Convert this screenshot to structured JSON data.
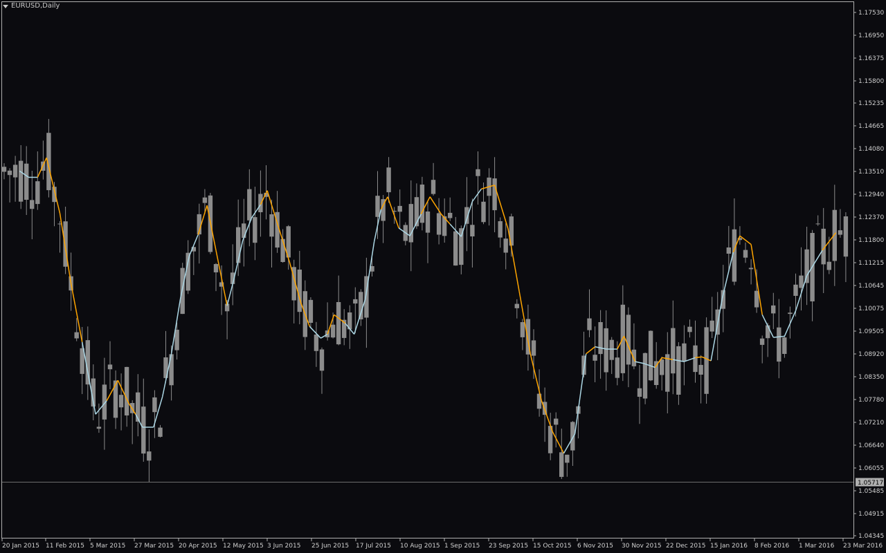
{
  "window": {
    "title": "EURUSD,Daily",
    "menu_icon": "triangle-down-icon"
  },
  "colors": {
    "background": "#0b0b0f",
    "candles": "#8c8c8c",
    "border": "#b0b0b0",
    "text": "#d0d0d0",
    "ma_up": "#add8e6",
    "ma_down": "#ffa500",
    "current_price_line": "#6e6e6e",
    "current_price_label_bg": "#b0b0b0"
  },
  "chart_data": {
    "type": "candlestick",
    "symbol": "EURUSD",
    "timeframe": "Daily",
    "ylim": [
      1.0434,
      1.1776
    ],
    "y_ticks": [
      "1.17530",
      "1.16950",
      "1.16375",
      "1.15800",
      "1.15235",
      "1.14665",
      "1.14080",
      "1.13510",
      "1.12940",
      "1.12370",
      "1.11800",
      "1.11215",
      "1.10645",
      "1.10075",
      "1.09505",
      "1.08920",
      "1.08350",
      "1.07780",
      "1.07210",
      "1.06640",
      "1.06055",
      "1.05485",
      "1.04915",
      "1.04345"
    ],
    "x_ticks": [
      "20 Jan 2015",
      "11 Feb 2015",
      "5 Mar 2015",
      "27 Mar 2015",
      "20 Apr 2015",
      "12 May 2015",
      "3 Jun 2015",
      "25 Jun 2015",
      "17 Jul 2015",
      "10 Aug 2015",
      "1 Sep 2015",
      "23 Sep 2015",
      "15 Oct 2015",
      "6 Nov 2015",
      "30 Nov 2015",
      "22 Dec 2015",
      "15 Jan 2016",
      "8 Feb 2016",
      "1 Mar 2016",
      "23 Mar 2016"
    ],
    "current_price": "1.05717",
    "grid": false,
    "indicators": [
      {
        "type": "moving-average",
        "up_color": "#add8e6",
        "down_color": "#ffa500",
        "points": [
          [
            14,
            1.1368,
            "down"
          ],
          [
            22,
            1.1352,
            "up"
          ],
          [
            30,
            1.1352,
            "up"
          ],
          [
            38,
            1.1402,
            "down"
          ],
          [
            50,
            1.126,
            "down"
          ],
          [
            60,
            1.108,
            "down"
          ],
          [
            70,
            1.093,
            "down"
          ],
          [
            82,
            1.0745,
            "up"
          ],
          [
            92,
            1.078,
            "up"
          ],
          [
            102,
            1.0832,
            "down"
          ],
          [
            112,
            1.0772,
            "down"
          ],
          [
            118,
            1.0745,
            "down"
          ],
          [
            124,
            1.0712,
            "up"
          ],
          [
            134,
            1.0712,
            "up"
          ],
          [
            142,
            1.079,
            "up"
          ],
          [
            150,
            1.09,
            "up"
          ],
          [
            158,
            1.104,
            "up"
          ],
          [
            166,
            1.115,
            "up"
          ],
          [
            174,
            1.1205,
            "up"
          ],
          [
            182,
            1.128,
            "down"
          ],
          [
            190,
            1.1165,
            "down"
          ],
          [
            200,
            1.1023,
            "down"
          ],
          [
            206,
            1.109,
            "up"
          ],
          [
            214,
            1.119,
            "up"
          ],
          [
            222,
            1.1248,
            "up"
          ],
          [
            230,
            1.1282,
            "up"
          ],
          [
            236,
            1.1318,
            "down"
          ],
          [
            246,
            1.1225,
            "down"
          ],
          [
            256,
            1.1135,
            "down"
          ],
          [
            266,
            1.1032,
            "down"
          ],
          [
            274,
            1.097,
            "down"
          ],
          [
            284,
            1.094,
            "up"
          ],
          [
            290,
            1.095,
            "up"
          ],
          [
            296,
            1.1,
            "down"
          ],
          [
            306,
            1.0978,
            "down"
          ],
          [
            314,
            1.095,
            "up"
          ],
          [
            324,
            1.104,
            "up"
          ],
          [
            332,
            1.1188,
            "up"
          ],
          [
            338,
            1.127,
            "up"
          ],
          [
            344,
            1.1302,
            "down"
          ],
          [
            354,
            1.1222,
            "down"
          ],
          [
            364,
            1.1202,
            "up"
          ],
          [
            374,
            1.1258,
            "up"
          ],
          [
            382,
            1.1302,
            "down"
          ],
          [
            392,
            1.1258,
            "down"
          ],
          [
            400,
            1.1232,
            "down"
          ],
          [
            410,
            1.12,
            "up"
          ],
          [
            420,
            1.129,
            "up"
          ],
          [
            428,
            1.1322,
            "up"
          ],
          [
            440,
            1.1332,
            "down"
          ],
          [
            452,
            1.122,
            "down"
          ],
          [
            462,
            1.106,
            "down"
          ],
          [
            472,
            1.09,
            "down"
          ],
          [
            482,
            1.078,
            "down"
          ],
          [
            492,
            1.07,
            "down"
          ],
          [
            502,
            1.0645,
            "down"
          ],
          [
            512,
            1.0695,
            "up"
          ],
          [
            522,
            1.09,
            "up"
          ],
          [
            530,
            1.0918,
            "down"
          ],
          [
            540,
            1.0912,
            "up"
          ],
          [
            550,
            1.0912,
            "up"
          ],
          [
            556,
            1.0945,
            "down"
          ],
          [
            566,
            1.088,
            "down"
          ],
          [
            574,
            1.0875,
            "up"
          ],
          [
            584,
            1.0865,
            "up"
          ],
          [
            590,
            1.089,
            "down"
          ],
          [
            600,
            1.0885,
            "down"
          ],
          [
            610,
            1.088,
            "up"
          ],
          [
            620,
            1.089,
            "up"
          ],
          [
            626,
            1.0892,
            "down"
          ],
          [
            634,
            1.0882,
            "down"
          ],
          [
            644,
            1.104,
            "up"
          ],
          [
            654,
            1.116,
            "up"
          ],
          [
            660,
            1.1202,
            "down"
          ],
          [
            670,
            1.118,
            "down"
          ],
          [
            680,
            1.1,
            "down"
          ],
          [
            690,
            1.0942,
            "up"
          ],
          [
            700,
            1.0945,
            "up"
          ],
          [
            710,
            1.101,
            "up"
          ],
          [
            720,
            1.11,
            "up"
          ],
          [
            734,
            1.1165,
            "up"
          ],
          [
            746,
            1.121,
            "down"
          ]
        ]
      }
    ]
  },
  "current_price_label": "1.05717"
}
